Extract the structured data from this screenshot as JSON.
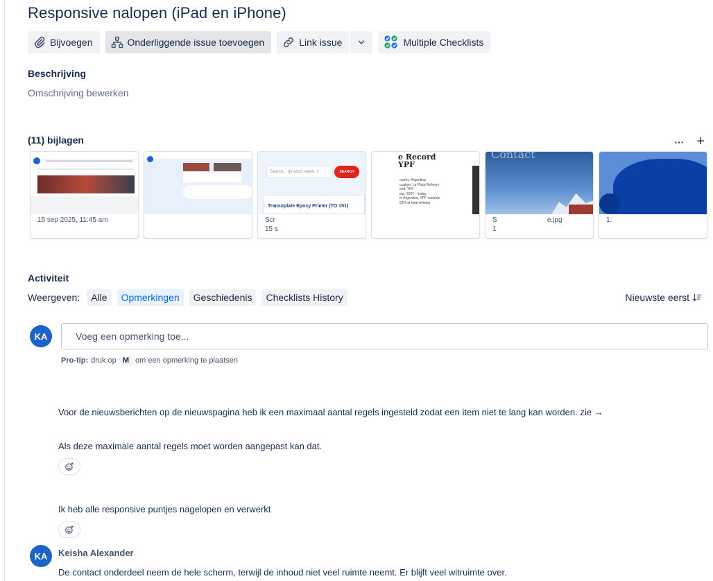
{
  "issue": {
    "title": "Responsive nalopen (iPad en iPhone)"
  },
  "toolbar": {
    "attach": "Bijvoegen",
    "child_issue": "Onderliggende issue toevoegen",
    "link_issue": "Link issue",
    "checklists": "Multiple Checklists"
  },
  "description": {
    "heading": "Beschrijving",
    "placeholder": "Omschrijving bewerken"
  },
  "attachments": {
    "heading": "(11) bijlagen",
    "more": "···",
    "add": "+",
    "items": [
      {
        "meta": "15 sep 2025, 11:45 am"
      },
      {
        "meta": ""
      },
      {
        "meta": "Scr\n15 s"
      },
      {
        "meta": ""
      },
      {
        "meta": "S                          e.jpg\n1"
      },
      {
        "meta": "1:"
      }
    ],
    "thumb3_search": "Search... (product name, c",
    "thumb3_button": "SEARCH",
    "thumb3_product": "Transoplate Epoxy Primer (TO 151)",
    "thumb4_heading": "e Record\nYPF",
    "thumb4_body": "ountry: Argentina\nocation: La Plata Refinery\nient: YPF\near: 2007 – today\nIn Argentina, YPF controls\n52% of total refining",
    "thumb5_text": "Contact"
  },
  "activity": {
    "heading": "Activiteit",
    "show_label": "Weergeven:",
    "filters": [
      "Alle",
      "Opmerkingen",
      "Geschiedenis",
      "Checklists History"
    ],
    "active_filter": "Opmerkingen",
    "sort": "Nieuwste eerst"
  },
  "comment_box": {
    "avatar": "KA",
    "placeholder": "Voeg een opmerking toe...",
    "protip_label": "Pro-tip:",
    "protip_pre": "druk op",
    "protip_key": "M",
    "protip_post": "om een opmerking te plaatsen"
  },
  "comments": [
    {
      "text": "Voor de nieuwsberichten op de nieuwspagina heb ik een maximaal aantal regels ingesteld zodat een item niet te lang kan worden. zie →"
    },
    {
      "text": "Als deze maximale aantal regels moet worden aangepast kan dat."
    },
    {
      "text": "Ik heb alle responsive puntjes nagelopen en verwerkt"
    }
  ],
  "last_comment": {
    "avatar": "KA",
    "author": "Keisha Alexander",
    "text": "De contact onderdeel neem de hele scherm, terwijl de inhoud niet veel ruimte neemt. Er blijft veel witruimte over."
  },
  "colors": {
    "accent": "#0c66e4",
    "avatar": "#1d62c7",
    "text": "#172b4d"
  }
}
